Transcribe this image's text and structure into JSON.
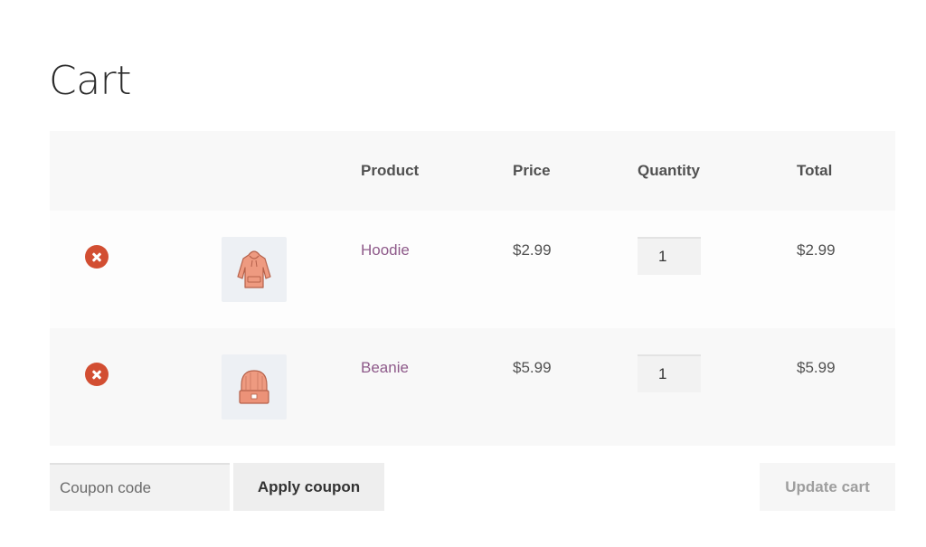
{
  "page": {
    "title": "Cart"
  },
  "cart": {
    "headers": {
      "remove": "",
      "thumbnail": "",
      "product": "Product",
      "price": "Price",
      "quantity": "Quantity",
      "total": "Total"
    },
    "items": [
      {
        "product": "Hoodie",
        "price": "$2.99",
        "quantity": "1",
        "total": "$2.99",
        "thumbnail_icon": "hoodie-icon"
      },
      {
        "product": "Beanie",
        "price": "$5.99",
        "quantity": "1",
        "total": "$5.99",
        "thumbnail_icon": "beanie-icon"
      }
    ]
  },
  "actions": {
    "coupon_placeholder": "Coupon code",
    "apply_coupon_label": "Apply coupon",
    "update_cart_label": "Update cart"
  },
  "colors": {
    "remove": "#d24e32",
    "product_link": "#8e5a8a",
    "header_bg": "#f8f8f8"
  }
}
